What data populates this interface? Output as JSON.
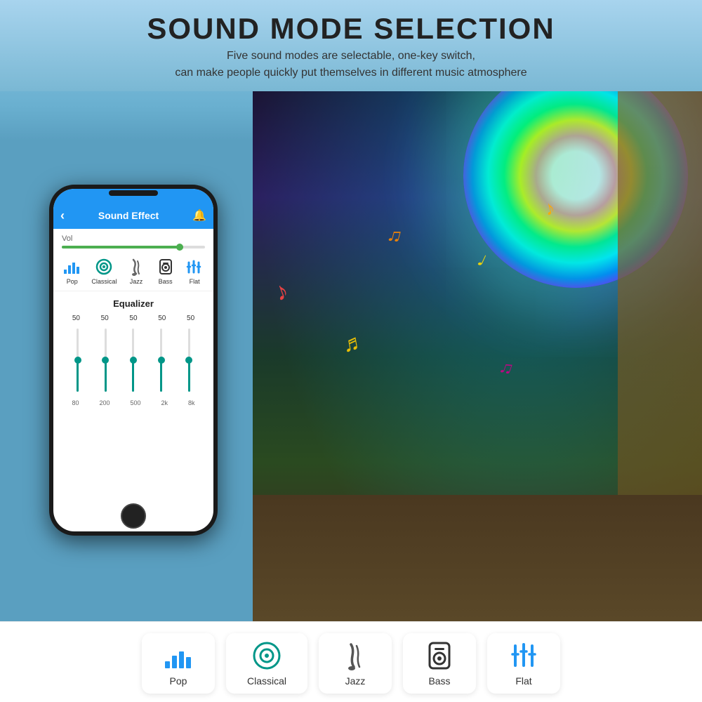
{
  "header": {
    "title": "SOUND MODE SELECTION",
    "subtitle_line1": "Five sound modes are selectable, one-key switch,",
    "subtitle_line2": "can make people quickly put themselves in different music atmosphere"
  },
  "app": {
    "header_title": "Sound Effect",
    "back_icon": "‹",
    "bell_icon": "🔔",
    "vol_label": "Vol",
    "equalizer_title": "Equalizer",
    "eq_values": [
      "50",
      "50",
      "50",
      "50",
      "50"
    ],
    "eq_freqs": [
      "80",
      "200",
      "500",
      "2k",
      "8k"
    ],
    "eq_heights": [
      50,
      50,
      50,
      50,
      50
    ],
    "sound_modes": [
      {
        "label": "Pop",
        "type": "pop"
      },
      {
        "label": "Classical",
        "type": "classical"
      },
      {
        "label": "Jazz",
        "type": "jazz"
      },
      {
        "label": "Bass",
        "type": "bass"
      },
      {
        "label": "Flat",
        "type": "flat"
      }
    ]
  },
  "bottom_icons": [
    {
      "label": "Pop",
      "type": "pop"
    },
    {
      "label": "Classical",
      "type": "classical"
    },
    {
      "label": "Jazz",
      "type": "jazz"
    },
    {
      "label": "Bass",
      "type": "bass"
    },
    {
      "label": "Flat",
      "type": "flat"
    }
  ],
  "colors": {
    "accent_blue": "#2196F3",
    "accent_green": "#4CAF50",
    "teal": "#009688"
  }
}
